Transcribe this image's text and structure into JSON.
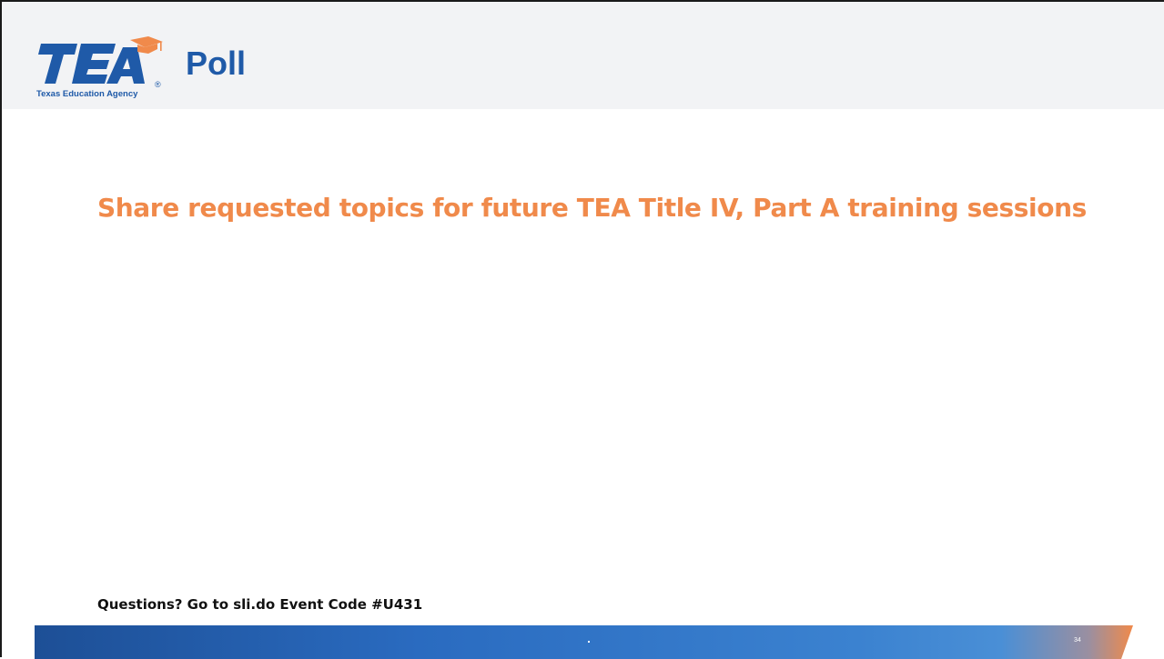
{
  "header": {
    "logo": {
      "wordmark": "TEA",
      "caption": "Texas Education Agency",
      "registered": "®"
    },
    "title": "Poll"
  },
  "main": {
    "subtitle": "Share requested topics for future TEA Title IV, Part A training sessions"
  },
  "footer": {
    "note": "Questions? Go to sli.do Event Code #U431",
    "slide_number": "34"
  },
  "colors": {
    "brand_blue": "#1f5aa8",
    "accent_orange": "#f08a4b",
    "header_bg": "#f2f3f5"
  }
}
